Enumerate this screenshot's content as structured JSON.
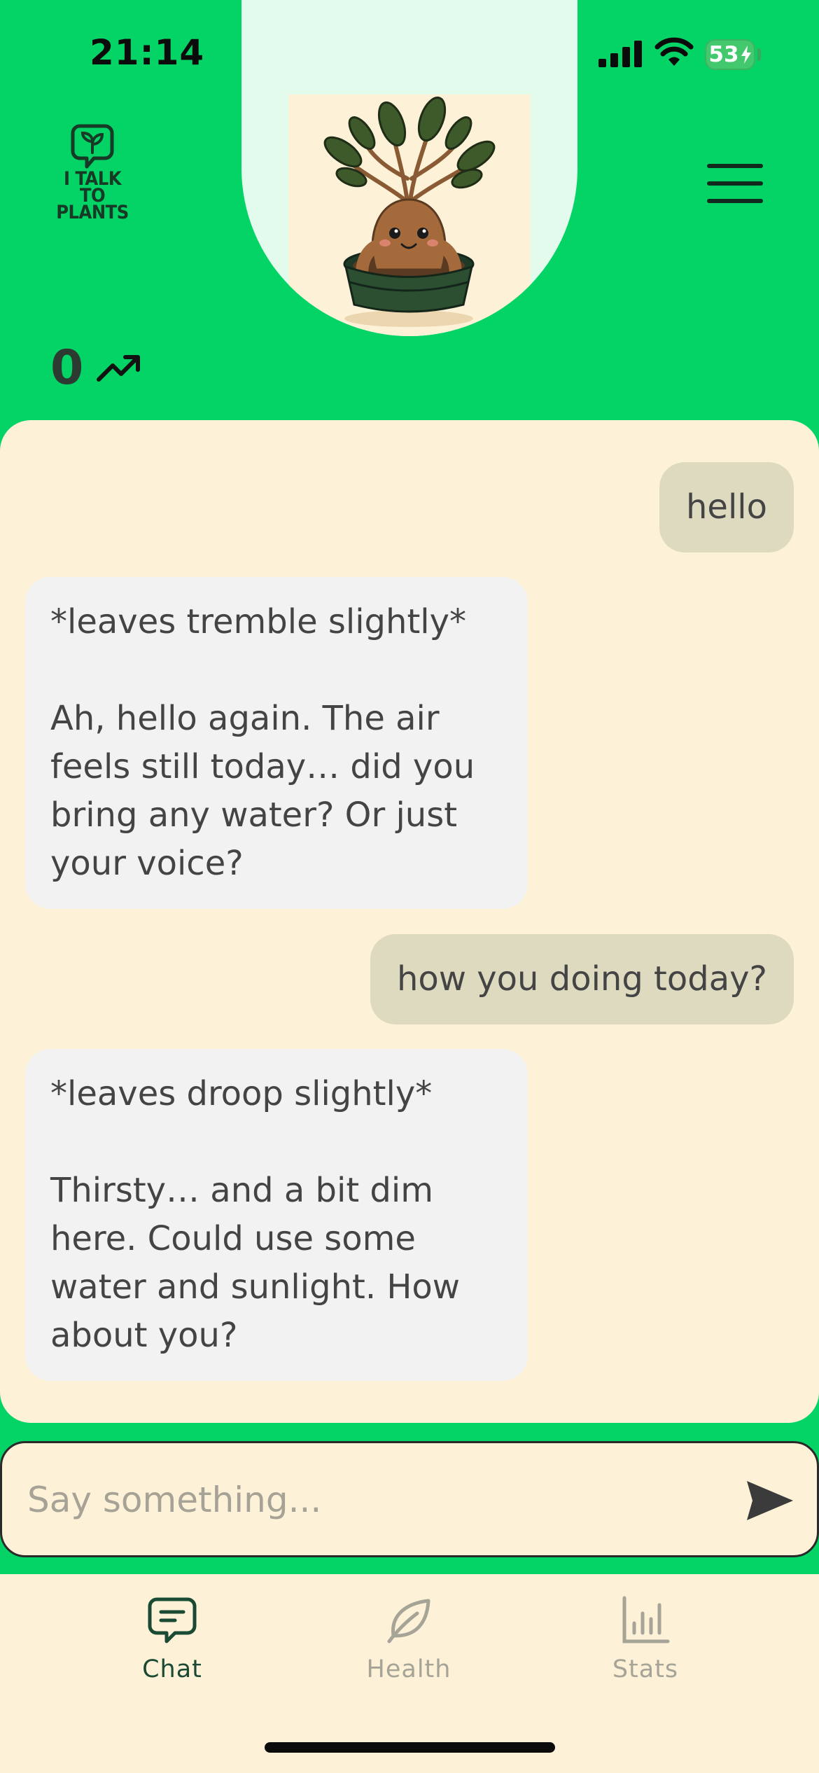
{
  "status_bar": {
    "time": "21:14",
    "battery": "53"
  },
  "header": {
    "logo_text": "I TALK\nTO\nPLANTS",
    "streak_count": "0"
  },
  "chat": {
    "messages": [
      {
        "role": "user",
        "text": "hello"
      },
      {
        "role": "plant",
        "text": "*leaves tremble slightly*\n\nAh, hello again. The air\nfeels still today… did you\nbring any water? Or just\nyour voice?"
      },
      {
        "role": "user",
        "text": "how you doing today?"
      },
      {
        "role": "plant",
        "text": "*leaves droop slightly*\n\nThirsty… and a bit dim\nhere. Could use some\nwater and sunlight. How\nabout you?"
      }
    ]
  },
  "composer": {
    "placeholder": "Say something..."
  },
  "tabs": [
    {
      "label": "Chat",
      "icon": "chat-bubble-icon",
      "active": true
    },
    {
      "label": "Health",
      "icon": "leaf-icon",
      "active": false
    },
    {
      "label": "Stats",
      "icon": "bar-chart-icon",
      "active": false
    }
  ],
  "colors": {
    "brand_green": "#03d465",
    "cream": "#fdf2d8",
    "user_bubble": "#dddac0",
    "plant_bubble": "#f2f2f2",
    "active_tab": "#1a4a34",
    "inactive_tab": "#a6a397"
  }
}
